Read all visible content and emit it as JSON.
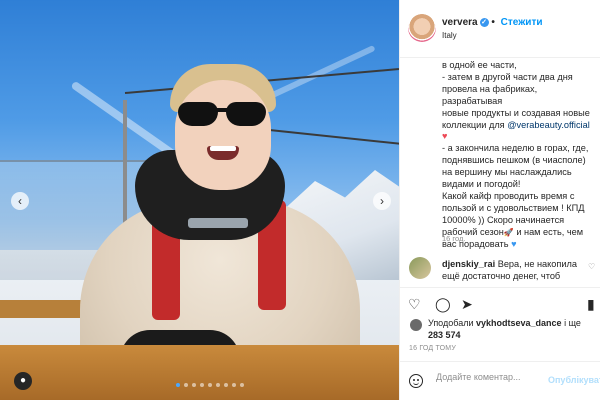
{
  "post": {
    "username": "ververa",
    "follow_label": "Стежити",
    "location": "Italy",
    "caption": {
      "lines": [
        "в одной ее части,",
        "- затем в другой части два дня",
        "провела на фабриках, разрабатывая",
        "новые продукты и создавая новые",
        "коллекции для "
      ],
      "mention": "@verabeauty.official",
      "heart": "♥",
      "lines2": [
        "- а закончила неделю в горах, где,",
        "поднявшись пешком (в чиасполе)",
        "на вершину мы наслаждались",
        "видами и погодой!",
        "Какой кайф проводить время с",
        "пользой и с удовольствием ! КПД",
        "10000% )) Скоро начинается",
        "рабочий сезон",
        " и нам есть, чем",
        "вас порадовать"
      ],
      "rocket": "🚀",
      "blue_heart": "♥"
    },
    "caption_time": "16 год.",
    "comment": {
      "username": "djenskiy_rai",
      "text": "Вера, не накопила ещё достаточно денег, чтоб"
    },
    "likes": {
      "prefix": "Уподобали",
      "user": "vykhodtseva_dance",
      "middle": "і ще",
      "count": "283 574"
    },
    "post_time": "16 ГОД ТОМУ",
    "add_comment_placeholder": "Додайте коментар...",
    "publish_label": "Опублікувати"
  },
  "icons": {
    "like": "♡",
    "comment": "◯",
    "share": "➤",
    "save": "▮",
    "prev": "‹",
    "next": "›",
    "tag": "●",
    "comment_like": "♡"
  },
  "colors": {
    "accent": "#0095f6",
    "verified": "#3897f0",
    "heart": "#ed4956"
  }
}
